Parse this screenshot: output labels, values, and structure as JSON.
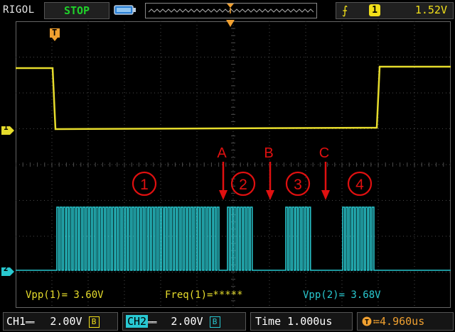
{
  "header": {
    "brand": "RIGOL",
    "run_state": "STOP",
    "trigger": {
      "channel": "1",
      "level": "1.52V"
    }
  },
  "markers": {
    "trigger_position": "T",
    "ch1_ground": "1",
    "ch2_ground": "2"
  },
  "annotations": {
    "labels": [
      "A",
      "B",
      "C"
    ],
    "bursts": [
      "1",
      "2",
      "3",
      "4"
    ]
  },
  "measurements": {
    "vpp1": "Vpp(1)= 3.60V",
    "freq1": "Freq(1)=*****",
    "vpp2": "Vpp(2)= 3.68V"
  },
  "footer": {
    "ch1": {
      "label": "CH1",
      "coupling": "══",
      "scale": "2.00V",
      "bw": "B"
    },
    "ch2": {
      "label": "CH2",
      "coupling": "══",
      "scale": "2.00V",
      "bw": "B"
    },
    "time": "Time  1.000us",
    "offset": "≔4.960us"
  },
  "colors": {
    "ch1": "#e6dc2c",
    "ch2": "#29c8cf",
    "annotation": "#e01010",
    "grid": "#4a4a4a",
    "trigger_marker": "#f0a030"
  }
}
